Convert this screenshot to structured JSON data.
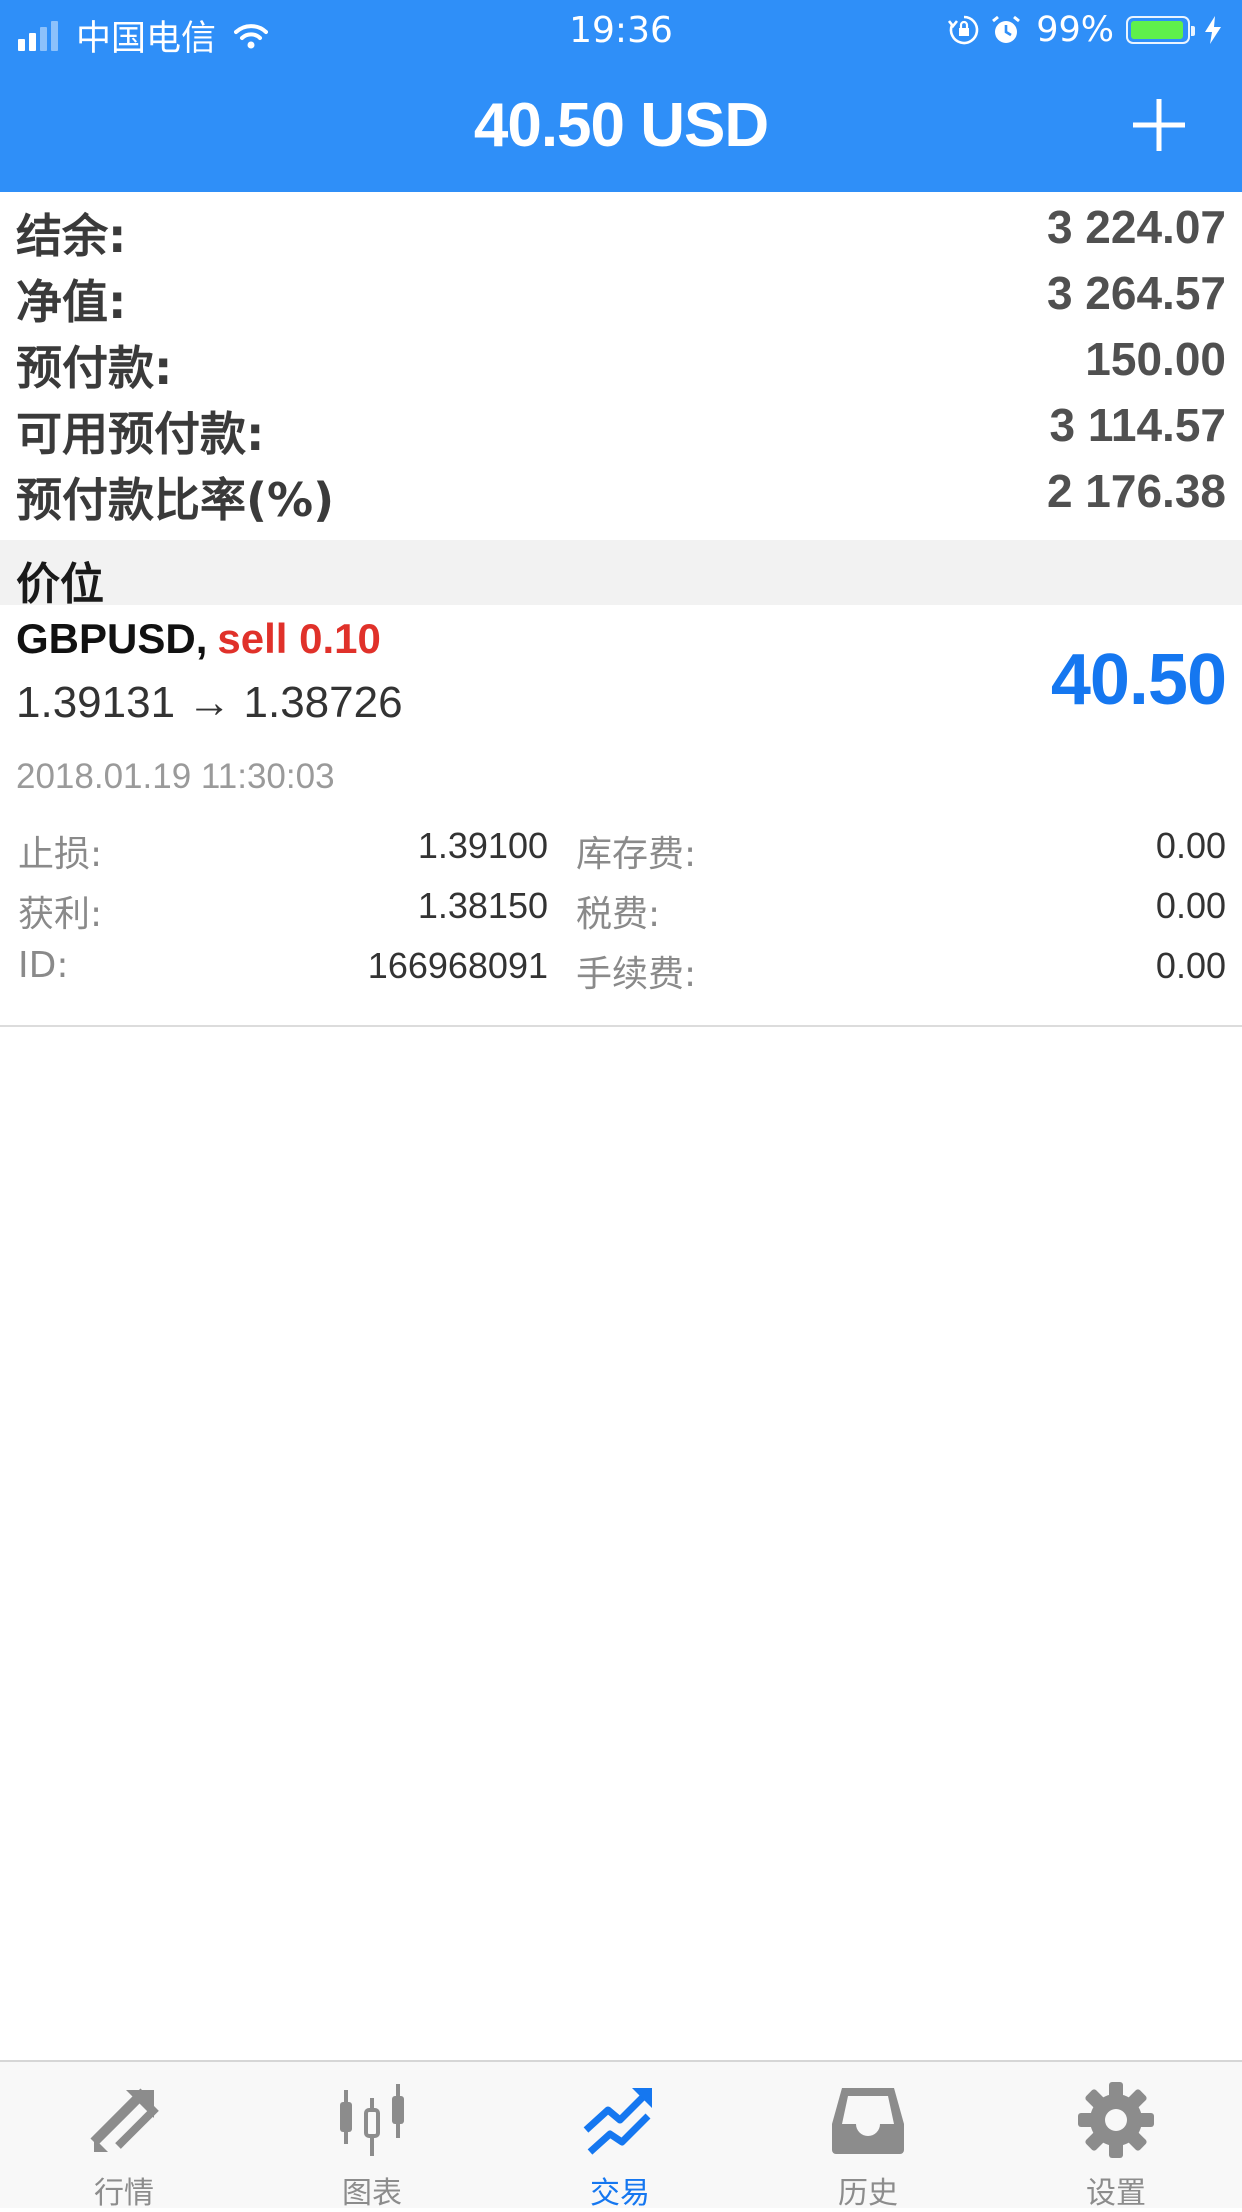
{
  "status_bar": {
    "carrier": "中国电信",
    "time": "19:36",
    "battery": "99%"
  },
  "header": {
    "title": "40.50 USD",
    "add_icon": "plus-icon"
  },
  "summary": [
    {
      "label": "结余:",
      "value": "3 224.07"
    },
    {
      "label": "净值:",
      "value": "3 264.57"
    },
    {
      "label": "预付款:",
      "value": "150.00"
    },
    {
      "label": "可用预付款:",
      "value": "3 114.57"
    },
    {
      "label": "预付款比率(%)",
      "value": "2 176.38"
    }
  ],
  "section": {
    "title": "价位"
  },
  "position": {
    "symbol": "GBPUSD,",
    "type": "sell 0.10",
    "prices": "1.39131 → 1.38726",
    "profit": "40.50",
    "time": "2018.01.19 11:30:03",
    "details": {
      "sl_label": "止损:",
      "sl_value": "1.39100",
      "tp_label": "获利:",
      "tp_value": "1.38150",
      "id_label": "ID:",
      "id_value": "166968091",
      "swap_label": "库存费:",
      "swap_value": "0.00",
      "tax_label": "税费:",
      "tax_value": "0.00",
      "commission_label": "手续费:",
      "commission_value": "0.00"
    }
  },
  "tabs": [
    {
      "label": "行情",
      "icon": "quotes-arrows-icon",
      "active": false
    },
    {
      "label": "图表",
      "icon": "candlestick-chart-icon",
      "active": false
    },
    {
      "label": "交易",
      "icon": "trade-trend-icon",
      "active": true
    },
    {
      "label": "历史",
      "icon": "history-inbox-icon",
      "active": false
    },
    {
      "label": "设置",
      "icon": "gear-icon",
      "active": false
    }
  ],
  "colors": {
    "header_bg": "#2f8ff8",
    "accent_blue": "#1577f0",
    "sell_red": "#e0312a",
    "battery_green": "#5ff04a"
  }
}
